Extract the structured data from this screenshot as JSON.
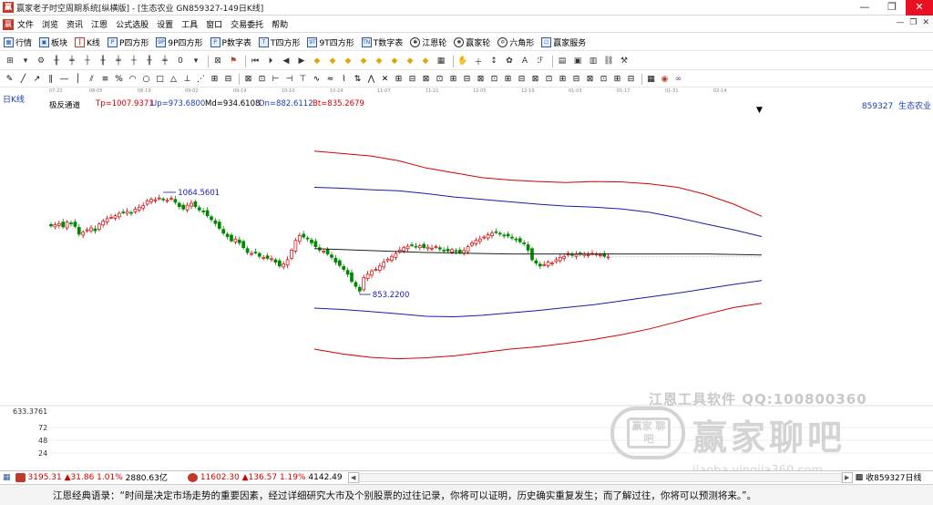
{
  "window": {
    "title": "赢家老子时空周期系统[纵横版] - [生态农业  GN859327-149日K线]",
    "minimize": "—",
    "restore": "❐",
    "close": "✕"
  },
  "menu": {
    "items": [
      "文件",
      "浏览",
      "资讯",
      "江恩",
      "公式选股",
      "设置",
      "工具",
      "窗口",
      "交易委托",
      "帮助"
    ],
    "mdi_controls": [
      "—",
      "❐",
      "✕"
    ]
  },
  "toolbar1": {
    "items": [
      {
        "label": "行情",
        "icon": "grid-icon"
      },
      {
        "label": "板块",
        "icon": "blocks-icon"
      },
      {
        "label": "K线",
        "icon": "kline-icon"
      },
      {
        "label": "P四方形",
        "icon": "p-square-icon"
      },
      {
        "label": "9P四方形",
        "icon": "9p-square-icon"
      },
      {
        "label": "P数字表",
        "icon": "p-table-icon"
      },
      {
        "label": "T四方形",
        "icon": "t-square-icon"
      },
      {
        "label": "9T四方形",
        "icon": "9t-square-icon"
      },
      {
        "label": "T数字表",
        "icon": "t-table-icon"
      },
      {
        "label": "江恩轮",
        "icon": "gann-wheel-icon"
      },
      {
        "label": "赢家轮",
        "icon": "winner-wheel-icon"
      },
      {
        "label": "六角形",
        "icon": "hexagon-icon"
      },
      {
        "label": "赢家服务",
        "icon": "service-icon"
      }
    ]
  },
  "chart_header": {
    "period": "日K线",
    "indicator_name": "极反通道",
    "tp": "Tp=1007.9371",
    "up": "Up=973.6800",
    "md": "Md=934.6108",
    "dn": "Dn=882.6112",
    "bt": "Bt=835.2679",
    "stock_code": "859327",
    "stock_name": "生态农业"
  },
  "date_ticks": [
    "07-22",
    "08-05",
    "08-19",
    "09-02",
    "09-19",
    "10-10",
    "10-24",
    "11-07",
    "11-21",
    "12-05",
    "12-19",
    "01-03",
    "01-17",
    "01-31",
    "02-14"
  ],
  "chart_data": {
    "type": "candlestick",
    "title": "",
    "y_labels_left": [
      "633.3761",
      "72",
      "48",
      "24"
    ],
    "annotations": [
      {
        "text": "1064.5601",
        "kind": "high"
      },
      {
        "text": "853.2200",
        "kind": "low"
      }
    ],
    "ohlc_close": [
      995,
      998,
      1000,
      993,
      1003,
      1000,
      994,
      978,
      982,
      987,
      991,
      985,
      999,
      1005,
      1010,
      1013,
      1016,
      1021,
      1023,
      1025,
      1021,
      1030,
      1034,
      1037,
      1047,
      1050,
      1049,
      1053,
      1050,
      1048,
      1052,
      1044,
      1035,
      1030,
      1038,
      1042,
      1035,
      1028,
      1024,
      1016,
      1008,
      1000,
      990,
      980,
      973,
      964,
      968,
      960,
      950,
      940,
      938,
      940,
      932,
      930,
      928,
      927,
      920,
      912,
      916,
      925,
      945,
      965,
      975,
      972,
      968,
      960,
      952,
      945,
      943,
      937,
      930,
      920,
      913,
      905,
      895,
      880,
      870,
      860,
      888,
      895,
      902,
      905,
      912,
      920,
      926,
      932,
      938,
      945,
      950,
      953,
      955,
      952,
      954,
      950,
      951,
      949,
      952,
      947,
      944,
      943,
      946,
      942,
      940,
      944,
      952,
      960,
      965,
      968,
      972,
      977,
      980,
      982,
      978,
      975,
      974,
      970,
      966,
      962,
      958,
      945,
      925,
      918,
      912,
      915,
      920,
      918,
      925,
      930,
      932,
      938,
      934,
      936,
      936,
      937,
      935,
      938,
      937,
      935,
      932,
      931
    ],
    "channel": {
      "tp": [
        1150,
        1145,
        1140,
        1130,
        1115,
        1105,
        1095,
        1090,
        1087,
        1085,
        1087,
        1086,
        1082,
        1075,
        1060,
        1040,
        1015
      ],
      "up": [
        1075,
        1073,
        1070,
        1068,
        1062,
        1055,
        1050,
        1045,
        1040,
        1036,
        1034,
        1030,
        1023,
        1012,
        999,
        987,
        973
      ],
      "md": [
        948,
        946,
        944,
        942,
        940,
        939,
        938,
        937,
        937,
        937,
        937,
        937,
        937,
        937,
        937,
        936,
        935
      ],
      "dn": [
        825,
        822,
        818,
        813,
        808,
        807,
        810,
        815,
        820,
        826,
        832,
        840,
        848,
        856,
        865,
        874,
        882
      ],
      "bt": [
        740,
        730,
        723,
        720,
        722,
        726,
        733,
        740,
        745,
        752,
        760,
        770,
        782,
        797,
        812,
        826,
        835
      ]
    }
  },
  "volume_axis": [
    "72",
    "48",
    "24"
  ],
  "watermark": {
    "line1": "江恩工具软件  QQ:100800360",
    "line2": "赢家聊吧",
    "line3": "jiaoba.yingjia360.com",
    "logo_text": "赢家 聊吧"
  },
  "statusbar": {
    "index1": "3195.31",
    "index1_change": "▲31.86 1.01%",
    "index1_amount": "2880.63亿",
    "index2": "11602.30",
    "index2_change": "▲136.57 1.19%",
    "index2_amount": "4142.49",
    "right_label": "收859327日线"
  },
  "footer": {
    "quote": "江恩经典语录：“时间是决定市场走势的重要因素，经过详细研究大市及个别股票的过往记录，你将可以证明，历史确实重复发生；而了解过往，你将可以预测将来。”。"
  }
}
